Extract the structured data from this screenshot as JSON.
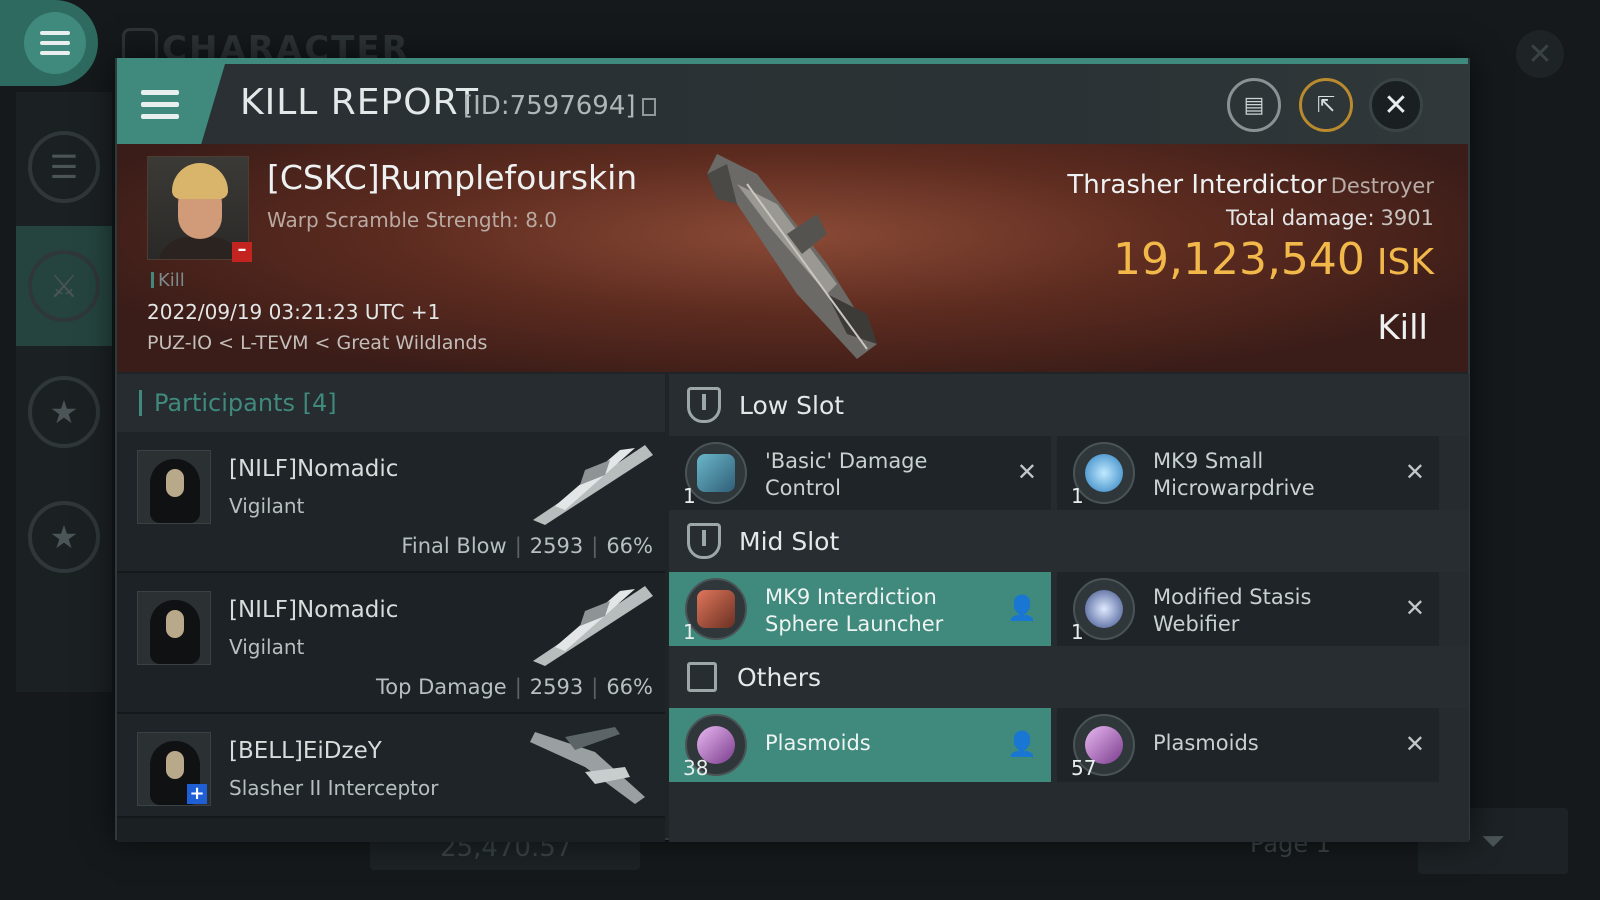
{
  "background": {
    "title": "CHARACTER",
    "footer_value": "25,470.57",
    "page_label": "Page 1"
  },
  "header": {
    "title": "KILL REPORT",
    "id": "[ID:7597694]",
    "buttons": {
      "clipboard": "clipboard-icon",
      "share": "share-icon",
      "close": "close-icon"
    }
  },
  "victim": {
    "name": "[CSKC]Rumplefourskin",
    "subtitle": "Warp Scramble Strength: 8.0",
    "tag": "Kill",
    "date": "2022/09/19 03:21:23 UTC +1",
    "location": "PUZ-IO < L-TEVM < Great Wildlands",
    "ship": "Thrasher Interdictor",
    "ship_class": "Destroyer",
    "total_damage_label": "Total damage:",
    "total_damage": "3901",
    "isk_value": "19,123,540",
    "isk_unit": "ISK",
    "result": "Kill"
  },
  "participants": {
    "header": "Participants [4]",
    "rows": [
      {
        "name": "[NILF]Nomadic",
        "ship": "Vigilant",
        "role": "Final Blow",
        "damage": "2593",
        "percent": "66%"
      },
      {
        "name": "[NILF]Nomadic",
        "ship": "Vigilant",
        "role": "Top Damage",
        "damage": "2593",
        "percent": "66%"
      },
      {
        "name": "[BELL]EiDzeY",
        "ship": "Slasher II Interceptor"
      }
    ]
  },
  "fittings": {
    "low_slot": {
      "label": "Low Slot",
      "items": [
        {
          "qty": "1",
          "name": "'Basic' Damage Control",
          "status": "dropped-x"
        },
        {
          "qty": "1",
          "name": "MK9 Small Microwarpdrive",
          "status": "dropped-x"
        }
      ]
    },
    "mid_slot": {
      "label": "Mid Slot",
      "items": [
        {
          "qty": "1",
          "name": "MK9 Interdiction Sphere Launcher",
          "status": "person"
        },
        {
          "qty": "1",
          "name": "Modified Stasis Webifier",
          "status": "dropped-x"
        }
      ]
    },
    "others": {
      "label": "Others",
      "items": [
        {
          "qty": "38",
          "name": "Plasmoids",
          "status": "person"
        },
        {
          "qty": "57",
          "name": "Plasmoids",
          "status": "dropped-x"
        }
      ]
    }
  },
  "colors": {
    "accent": "#3f8a7c",
    "isk": "#f2b84a",
    "banner": "#5e2c20"
  }
}
